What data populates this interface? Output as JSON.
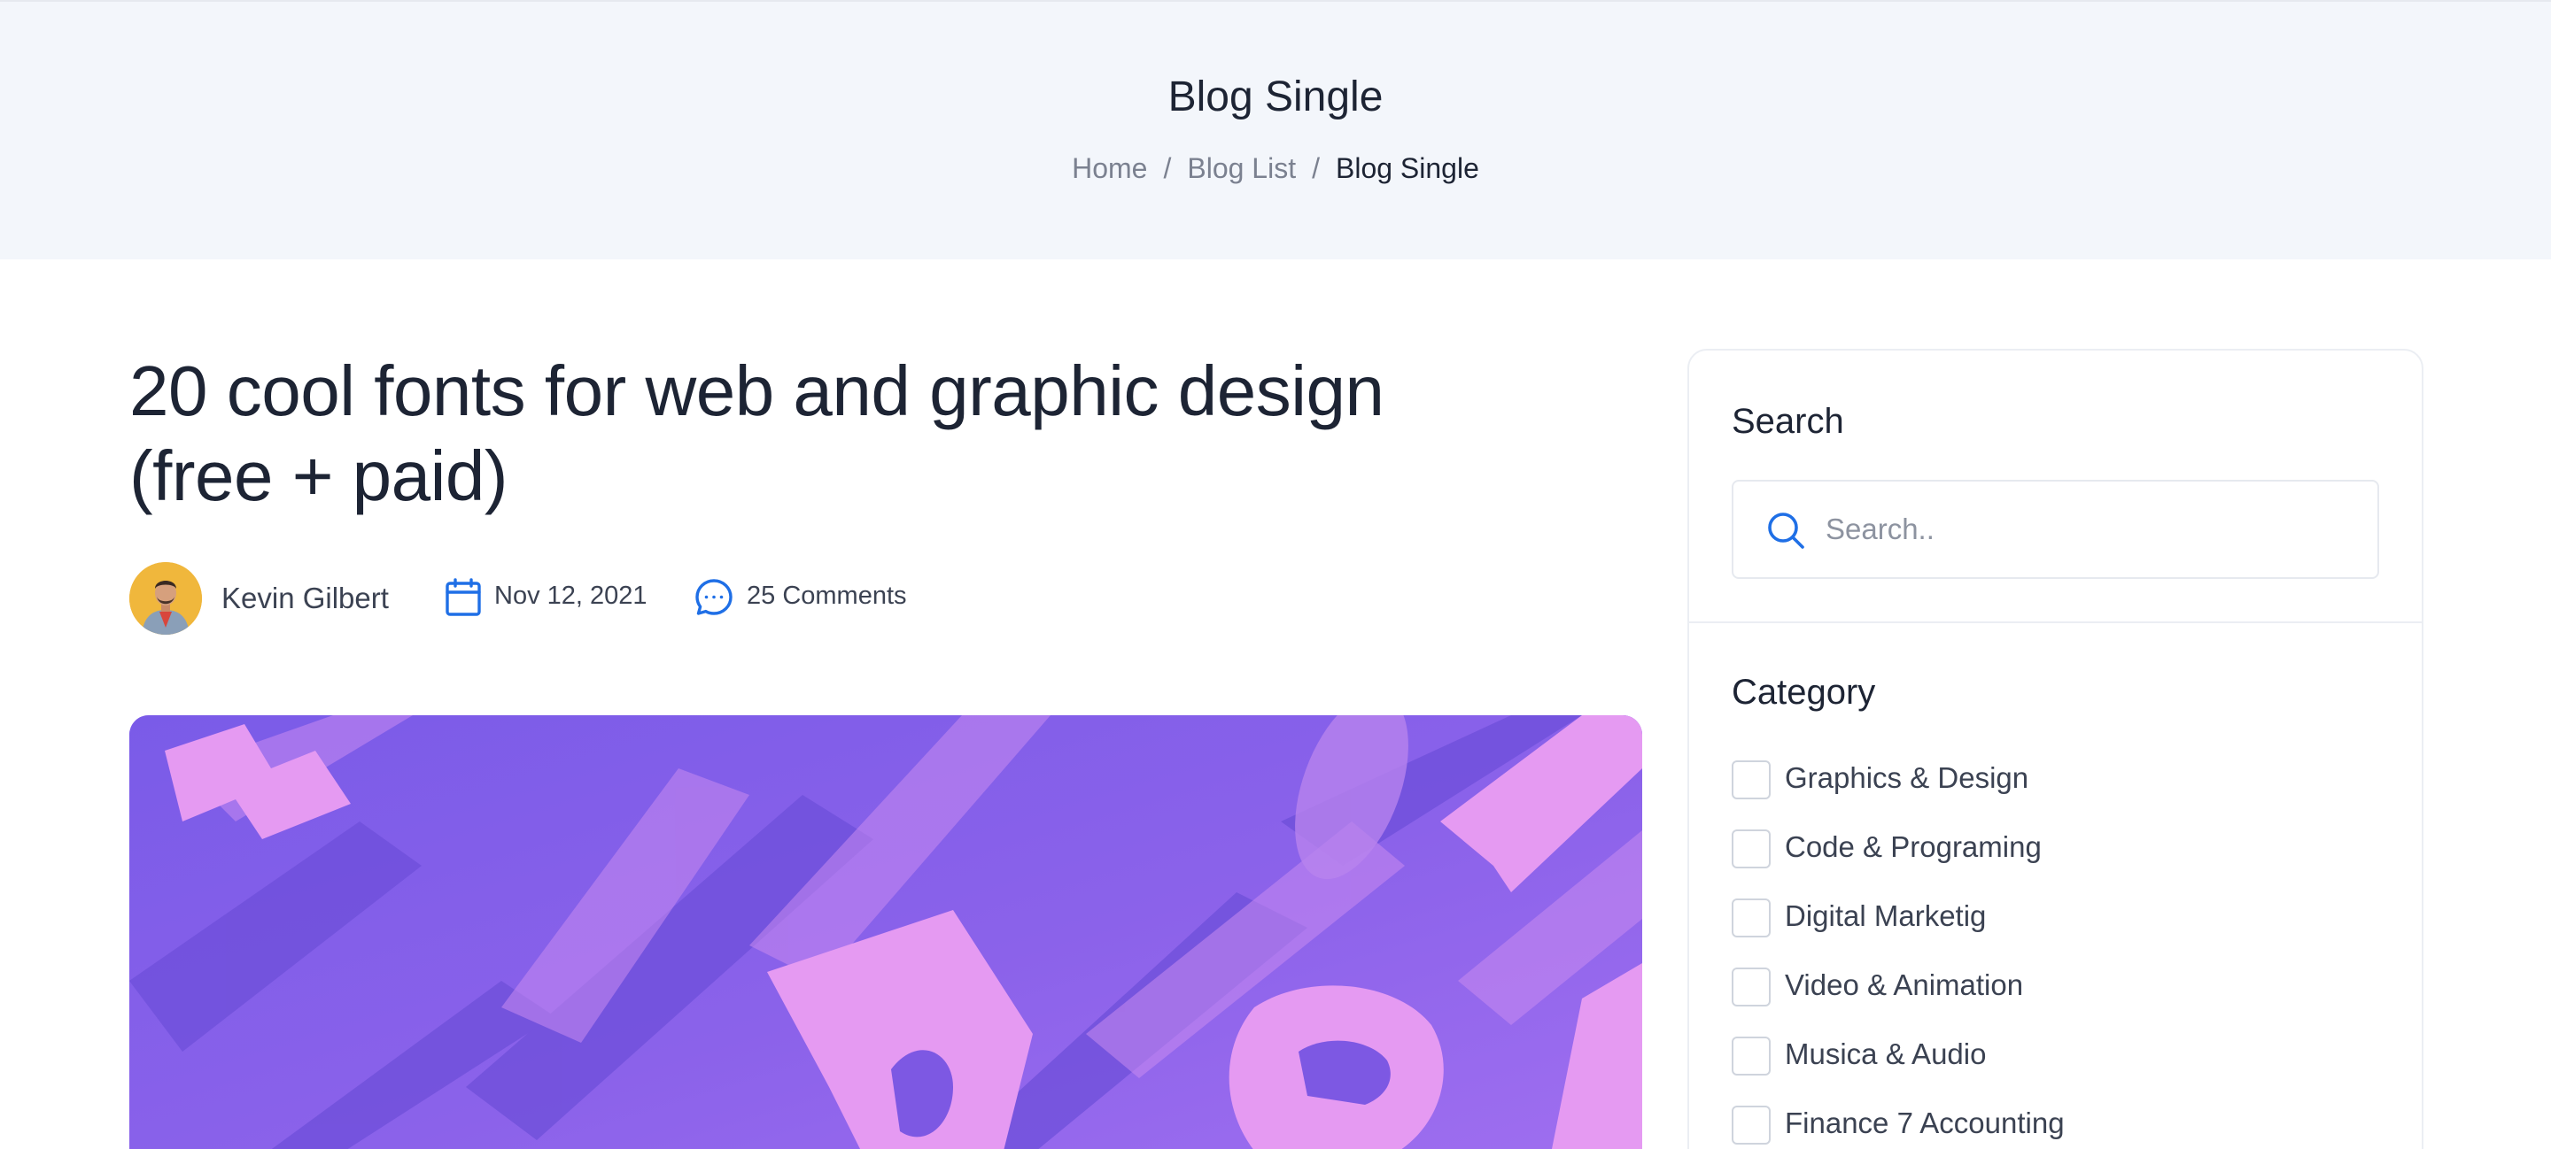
{
  "hero": {
    "title": "Blog Single",
    "breadcrumb": {
      "items": [
        "Home",
        "Blog List",
        "Blog Single"
      ],
      "separator": "/"
    }
  },
  "post": {
    "title_line1": "20 cool fonts for web and graphic design",
    "title_line2": "(free + paid)",
    "author": "Kevin Gilbert",
    "date": "Nov 12, 2021",
    "comments": "25 Comments"
  },
  "sidebar": {
    "search_title": "Search",
    "search_placeholder": "Search..",
    "category_title": "Category",
    "categories": [
      "Graphics & Design",
      "Code & Programing",
      "Digital Marketig",
      "Video & Animation",
      "Musica & Audio",
      "Finance 7 Accounting"
    ]
  },
  "icons": {
    "search": "search-icon",
    "calendar": "calendar-icon",
    "comment": "comment-icon"
  },
  "colors": {
    "accent": "#1f6fe6",
    "hero_bg": "#f3f6fb",
    "feature_purple": "#8a62ea",
    "feature_pink": "#e38ef0"
  }
}
